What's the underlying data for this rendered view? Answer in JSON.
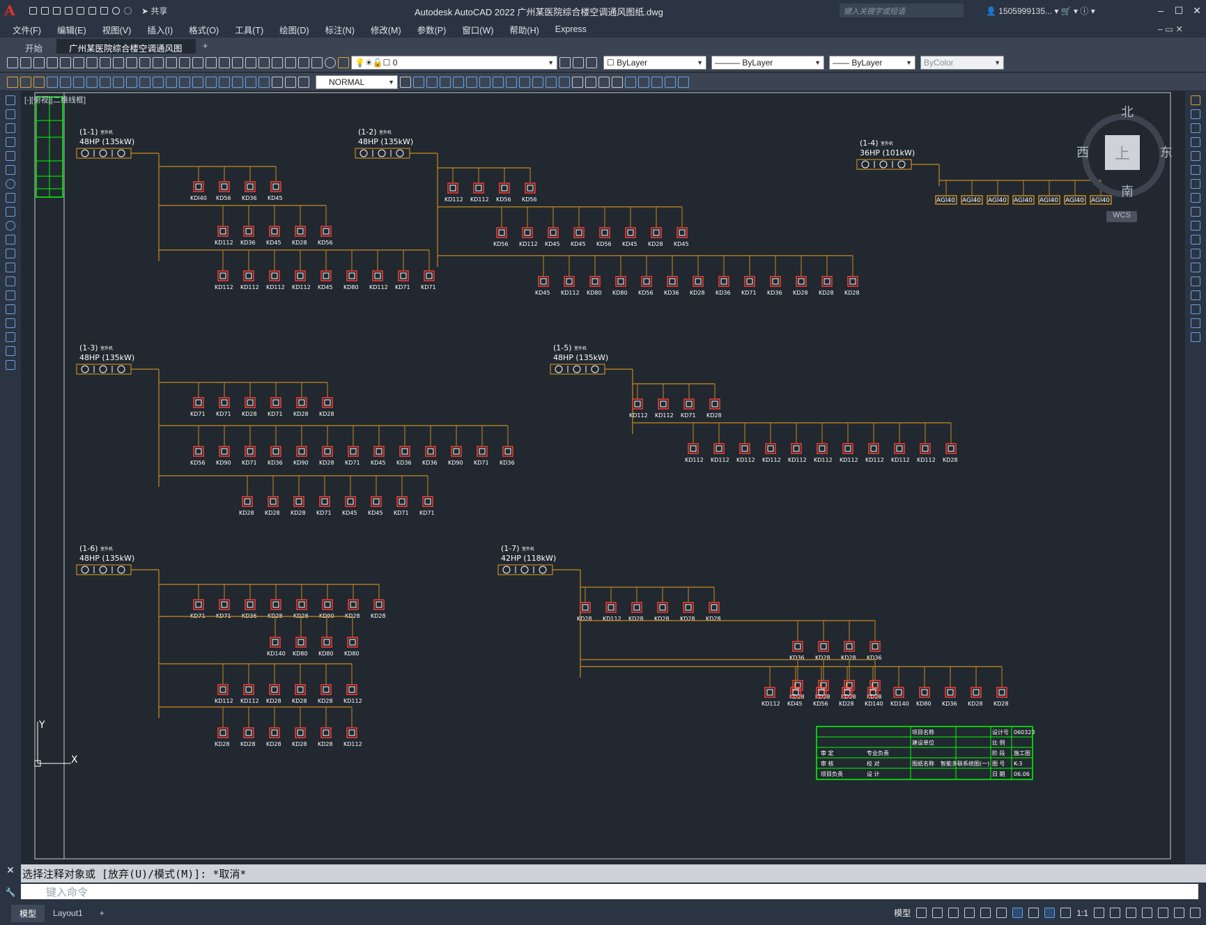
{
  "app": {
    "logo": "A",
    "title": "Autodesk AutoCAD 2022    广州某医院综合楼空调通风图纸.dwg",
    "search_placeholder": "键入关键字或短语",
    "user": "1505999135...",
    "share_label": "共享",
    "colors": {
      "bg": "#212830",
      "chrome": "#2b3442",
      "toolbar": "#3b4453",
      "pipe": "#c98a1e",
      "unit": "#ff3b2f",
      "frame": "#00ff00"
    }
  },
  "menu": [
    "文件(F)",
    "编辑(E)",
    "视图(V)",
    "插入(I)",
    "格式(O)",
    "工具(T)",
    "绘图(D)",
    "标注(N)",
    "修改(M)",
    "参数(P)",
    "窗口(W)",
    "帮助(H)",
    "Express"
  ],
  "tabs": [
    {
      "label": "开始"
    },
    {
      "label": "广州某医院综合楼空调通风图纸*"
    }
  ],
  "toolbar": {
    "layer": "0",
    "color": "ByLayer",
    "linetype": "ByLayer",
    "lineweight": "ByLayer",
    "plotstyle": "ByColor",
    "textstyle": "NORMAL"
  },
  "viewport": {
    "label": "[-][俯视][二维线框]",
    "viewcube": {
      "north": "北",
      "south": "南",
      "east": "东",
      "west": "西",
      "face": "上",
      "wcs": "WCS"
    },
    "ucs": {
      "x": "X",
      "y": "Y"
    }
  },
  "drawing": {
    "systems": [
      {
        "name": "(1-1)",
        "sub": "室外机",
        "cap": "48HP (135kW)",
        "branches": [
          [
            "KDl40",
            "KD56",
            "KD36",
            "KD45"
          ],
          [
            "KD112",
            "KD36",
            "KD45",
            "KD28",
            "KD56"
          ],
          [
            "KD112",
            "KD112",
            "KD112",
            "KD112",
            "KD45",
            "KD80",
            "KD112",
            "KD71",
            "KD71"
          ]
        ]
      },
      {
        "name": "(1-2)",
        "sub": "室外机",
        "cap": "48HP (135kW)",
        "branches": [
          [
            "KD112",
            "KD112",
            "KD56",
            "KD56"
          ],
          [
            "KD56",
            "KD112",
            "KD45",
            "KD45",
            "KD56",
            "KD45",
            "KD28",
            "KD45"
          ],
          [
            "KD45",
            "KD112",
            "KD80",
            "KD80",
            "KD56",
            "KD36",
            "KD28",
            "KD36",
            "KD71",
            "KD36",
            "KD28",
            "KD28",
            "KD28"
          ]
        ]
      },
      {
        "name": "(1-4)",
        "sub": "室外机",
        "cap": "36HP (101kW)",
        "branches": [
          [
            "AGl40",
            "AGl40",
            "AGl40",
            "AGl40",
            "AGl40",
            "AGl40",
            "AGl40"
          ]
        ]
      },
      {
        "name": "(1-3)",
        "sub": "室外机",
        "cap": "48HP (135kW)",
        "branches": [
          [
            "KD71",
            "KD71",
            "KD28",
            "KD71",
            "KD28",
            "KD28"
          ],
          [
            "KD56",
            "KD90",
            "KD71",
            "KD36",
            "KD90",
            "KD28",
            "KD71",
            "KD45",
            "KD36",
            "KD36",
            "KD90",
            "KD71",
            "KD36"
          ],
          [
            "KD28",
            "KD28",
            "KD28",
            "KD71",
            "KD45",
            "KD45",
            "KD71",
            "KD71"
          ]
        ]
      },
      {
        "name": "(1-5)",
        "sub": "室外机",
        "cap": "48HP (135kW)",
        "branches": [
          [
            "KD112",
            "KD112",
            "KD71",
            "KD28"
          ],
          [
            "KD112",
            "KD112",
            "KD112",
            "KD112",
            "KD112",
            "KD112",
            "KD112",
            "KD112",
            "KD112",
            "KD112",
            "KD28"
          ]
        ]
      },
      {
        "name": "(1-6)",
        "sub": "室外机",
        "cap": "48HP (135kW)",
        "branches": [
          [
            "KD71",
            "KD71",
            "KD36",
            "KD28",
            "KD28",
            "KD90",
            "KD28",
            "KD28"
          ],
          [
            "KD140",
            "KD80",
            "KD80",
            "KD80"
          ],
          [
            "KD112",
            "KD112",
            "KD28",
            "KD28",
            "KD28",
            "KD112"
          ],
          [
            "KD28",
            "KD28",
            "KD28",
            "KD28",
            "KD28",
            "KD112"
          ]
        ]
      },
      {
        "name": "(1-7)",
        "sub": "室外机",
        "cap": "42HP (118kW)",
        "branches": [
          [
            "KD28",
            "KD112",
            "KD28",
            "KD28",
            "KD28",
            "KD28"
          ],
          [
            "KD36",
            "KD28",
            "KD28",
            "KD36"
          ],
          [
            "KD28",
            "KD28",
            "KD28",
            "KD28"
          ],
          [
            "KD112",
            "KD45",
            "KD56",
            "KD28",
            "KD140",
            "KD140",
            "KD80",
            "KD36",
            "KD28",
            "KD28"
          ]
        ]
      }
    ],
    "titleblock": {
      "rows": [
        "项目名称",
        "建设单位",
        "审  定",
        "审  核",
        "项目负责",
        "专业负责",
        "校  对",
        "设  计",
        "图纸名称"
      ],
      "drawing_name": "智能多联系统图(一)",
      "fields": [
        "设计号",
        "比  例",
        "阶  段",
        "图  号",
        "日  期"
      ],
      "values": [
        "060323",
        "",
        "施工图",
        "K-3",
        "06.06"
      ]
    }
  },
  "command": {
    "history": "选择注释对象或 [放弃(U)/模式(M)]: *取消*",
    "placeholder": "键入命令"
  },
  "status": {
    "layout_tabs": [
      "模型",
      "Layout1"
    ],
    "model_label": "模型",
    "scale": "1:1"
  }
}
